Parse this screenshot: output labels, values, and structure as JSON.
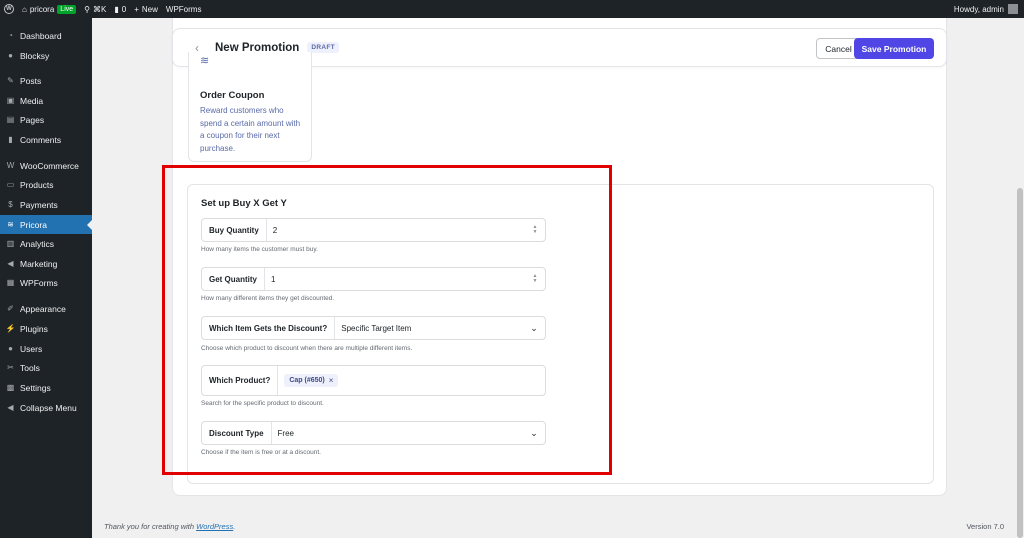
{
  "adminbar": {
    "site_name": "pricora",
    "live_badge": "Live",
    "shortcut": "⌘K",
    "comments_count": "0",
    "new_label": "New",
    "wpforms": "WPForms",
    "howdy": "Howdy, admin"
  },
  "sidebar": {
    "items": [
      {
        "label": "Dashboard",
        "icon": "dashboard-icon"
      },
      {
        "label": "Blocksy",
        "icon": "blocksy-icon"
      },
      {
        "label": "Posts",
        "icon": "pin-icon"
      },
      {
        "label": "Media",
        "icon": "media-icon"
      },
      {
        "label": "Pages",
        "icon": "page-icon"
      },
      {
        "label": "Comments",
        "icon": "comment-icon"
      },
      {
        "label": "WooCommerce",
        "icon": "woocommerce-icon"
      },
      {
        "label": "Products",
        "icon": "products-icon"
      },
      {
        "label": "Payments",
        "icon": "payments-icon"
      },
      {
        "label": "Pricora",
        "icon": "pricora-icon",
        "active": true
      },
      {
        "label": "Analytics",
        "icon": "analytics-icon"
      },
      {
        "label": "Marketing",
        "icon": "megaphone-icon"
      },
      {
        "label": "WPForms",
        "icon": "wpforms-icon"
      },
      {
        "label": "Appearance",
        "icon": "brush-icon"
      },
      {
        "label": "Plugins",
        "icon": "plugin-icon"
      },
      {
        "label": "Users",
        "icon": "users-icon"
      },
      {
        "label": "Tools",
        "icon": "wrench-icon"
      },
      {
        "label": "Settings",
        "icon": "settings-icon"
      },
      {
        "label": "Collapse Menu",
        "icon": "collapse-icon"
      }
    ]
  },
  "header": {
    "title": "New Promotion",
    "status": "DRAFT",
    "cancel_label": "Cancel",
    "save_label": "Save Promotion"
  },
  "coupon_card": {
    "title": "Order Coupon",
    "description": "Reward customers who spend a certain amount with a coupon for their next purchase."
  },
  "bxgy": {
    "title": "Set up Buy X Get Y",
    "buy_quantity": {
      "label": "Buy Quantity",
      "value": "2",
      "help": "How many items the customer must buy."
    },
    "get_quantity": {
      "label": "Get Quantity",
      "value": "1",
      "help": "How many different items they get discounted."
    },
    "which_item": {
      "label": "Which Item Gets the Discount?",
      "value": "Specific Target Item",
      "help": "Choose which product to discount when there are multiple different items."
    },
    "which_product": {
      "label": "Which Product?",
      "tag": "Cap (#650)",
      "help": "Search for the specific product to discount."
    },
    "discount_type": {
      "label": "Discount Type",
      "value": "Free",
      "help": "Choose if the item is free or at a discount."
    }
  },
  "footer": {
    "thanks_prefix": "Thank you for creating with ",
    "thanks_link": "WordPress",
    "thanks_suffix": ".",
    "version": "Version 7.0"
  },
  "colors": {
    "accent": "#4f46e5",
    "admin_dark": "#1d2327",
    "wp_blue": "#2271b1",
    "highlight_red": "#e00000"
  }
}
